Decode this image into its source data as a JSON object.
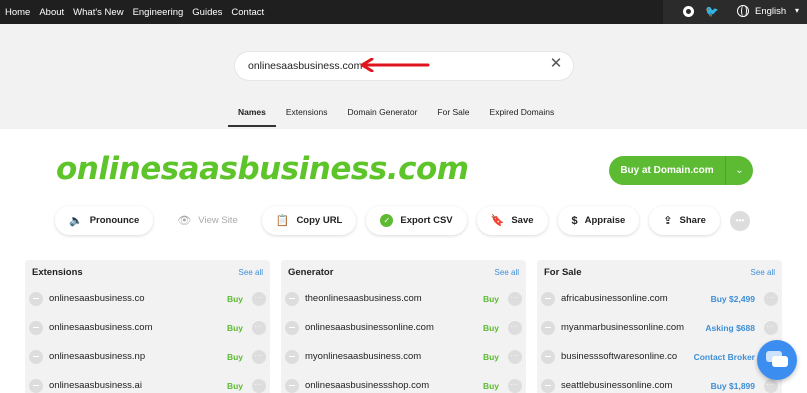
{
  "nav": {
    "links": [
      "Home",
      "About",
      "What's New",
      "Engineering",
      "Guides",
      "Contact"
    ],
    "language": "English"
  },
  "search": {
    "value": "onlinesaasbusiness.com",
    "clear_icon": "close-icon"
  },
  "tabs": [
    "Names",
    "Extensions",
    "Domain Generator",
    "For Sale",
    "Expired Domains"
  ],
  "active_tab": "Names",
  "domain": {
    "title": "onlinesaasbusiness.com",
    "buy_label": "Buy at Domain.com"
  },
  "actions": {
    "pronounce": "Pronounce",
    "view_site": "View Site",
    "copy_url": "Copy URL",
    "export_csv": "Export CSV",
    "save": "Save",
    "appraise": "Appraise",
    "share": "Share"
  },
  "panels": {
    "extensions": {
      "title": "Extensions",
      "see_all": "See all",
      "rows": [
        {
          "name": "onlinesaasbusiness.co",
          "action": "Buy"
        },
        {
          "name": "onlinesaasbusiness.com",
          "action": "Buy"
        },
        {
          "name": "onlinesaasbusiness.np",
          "action": "Buy"
        },
        {
          "name": "onlinesaasbusiness.ai",
          "action": "Buy"
        }
      ]
    },
    "generator": {
      "title": "Generator",
      "see_all": "See all",
      "rows": [
        {
          "name": "theonlinesaasbusiness.com",
          "action": "Buy"
        },
        {
          "name": "onlinesaasbusinessonline.com",
          "action": "Buy"
        },
        {
          "name": "myonlinesaasbusiness.com",
          "action": "Buy"
        },
        {
          "name": "onlinesaasbusinessshop.com",
          "action": "Buy"
        }
      ]
    },
    "for_sale": {
      "title": "For Sale",
      "see_all": "See all",
      "rows": [
        {
          "name": "africabusinessonline.com",
          "action": "Buy $2,499"
        },
        {
          "name": "myanmarbusinessonline.com",
          "action": "Asking $688"
        },
        {
          "name": "businesssoftwaresonline.co",
          "action": "Contact Broker"
        },
        {
          "name": "seattlebusinessonline.com",
          "action": "Buy $1,899"
        }
      ]
    }
  },
  "colors": {
    "brand_green": "#5dc42a",
    "link_blue": "#3d8fd8",
    "arrow_red": "#e0141e"
  }
}
